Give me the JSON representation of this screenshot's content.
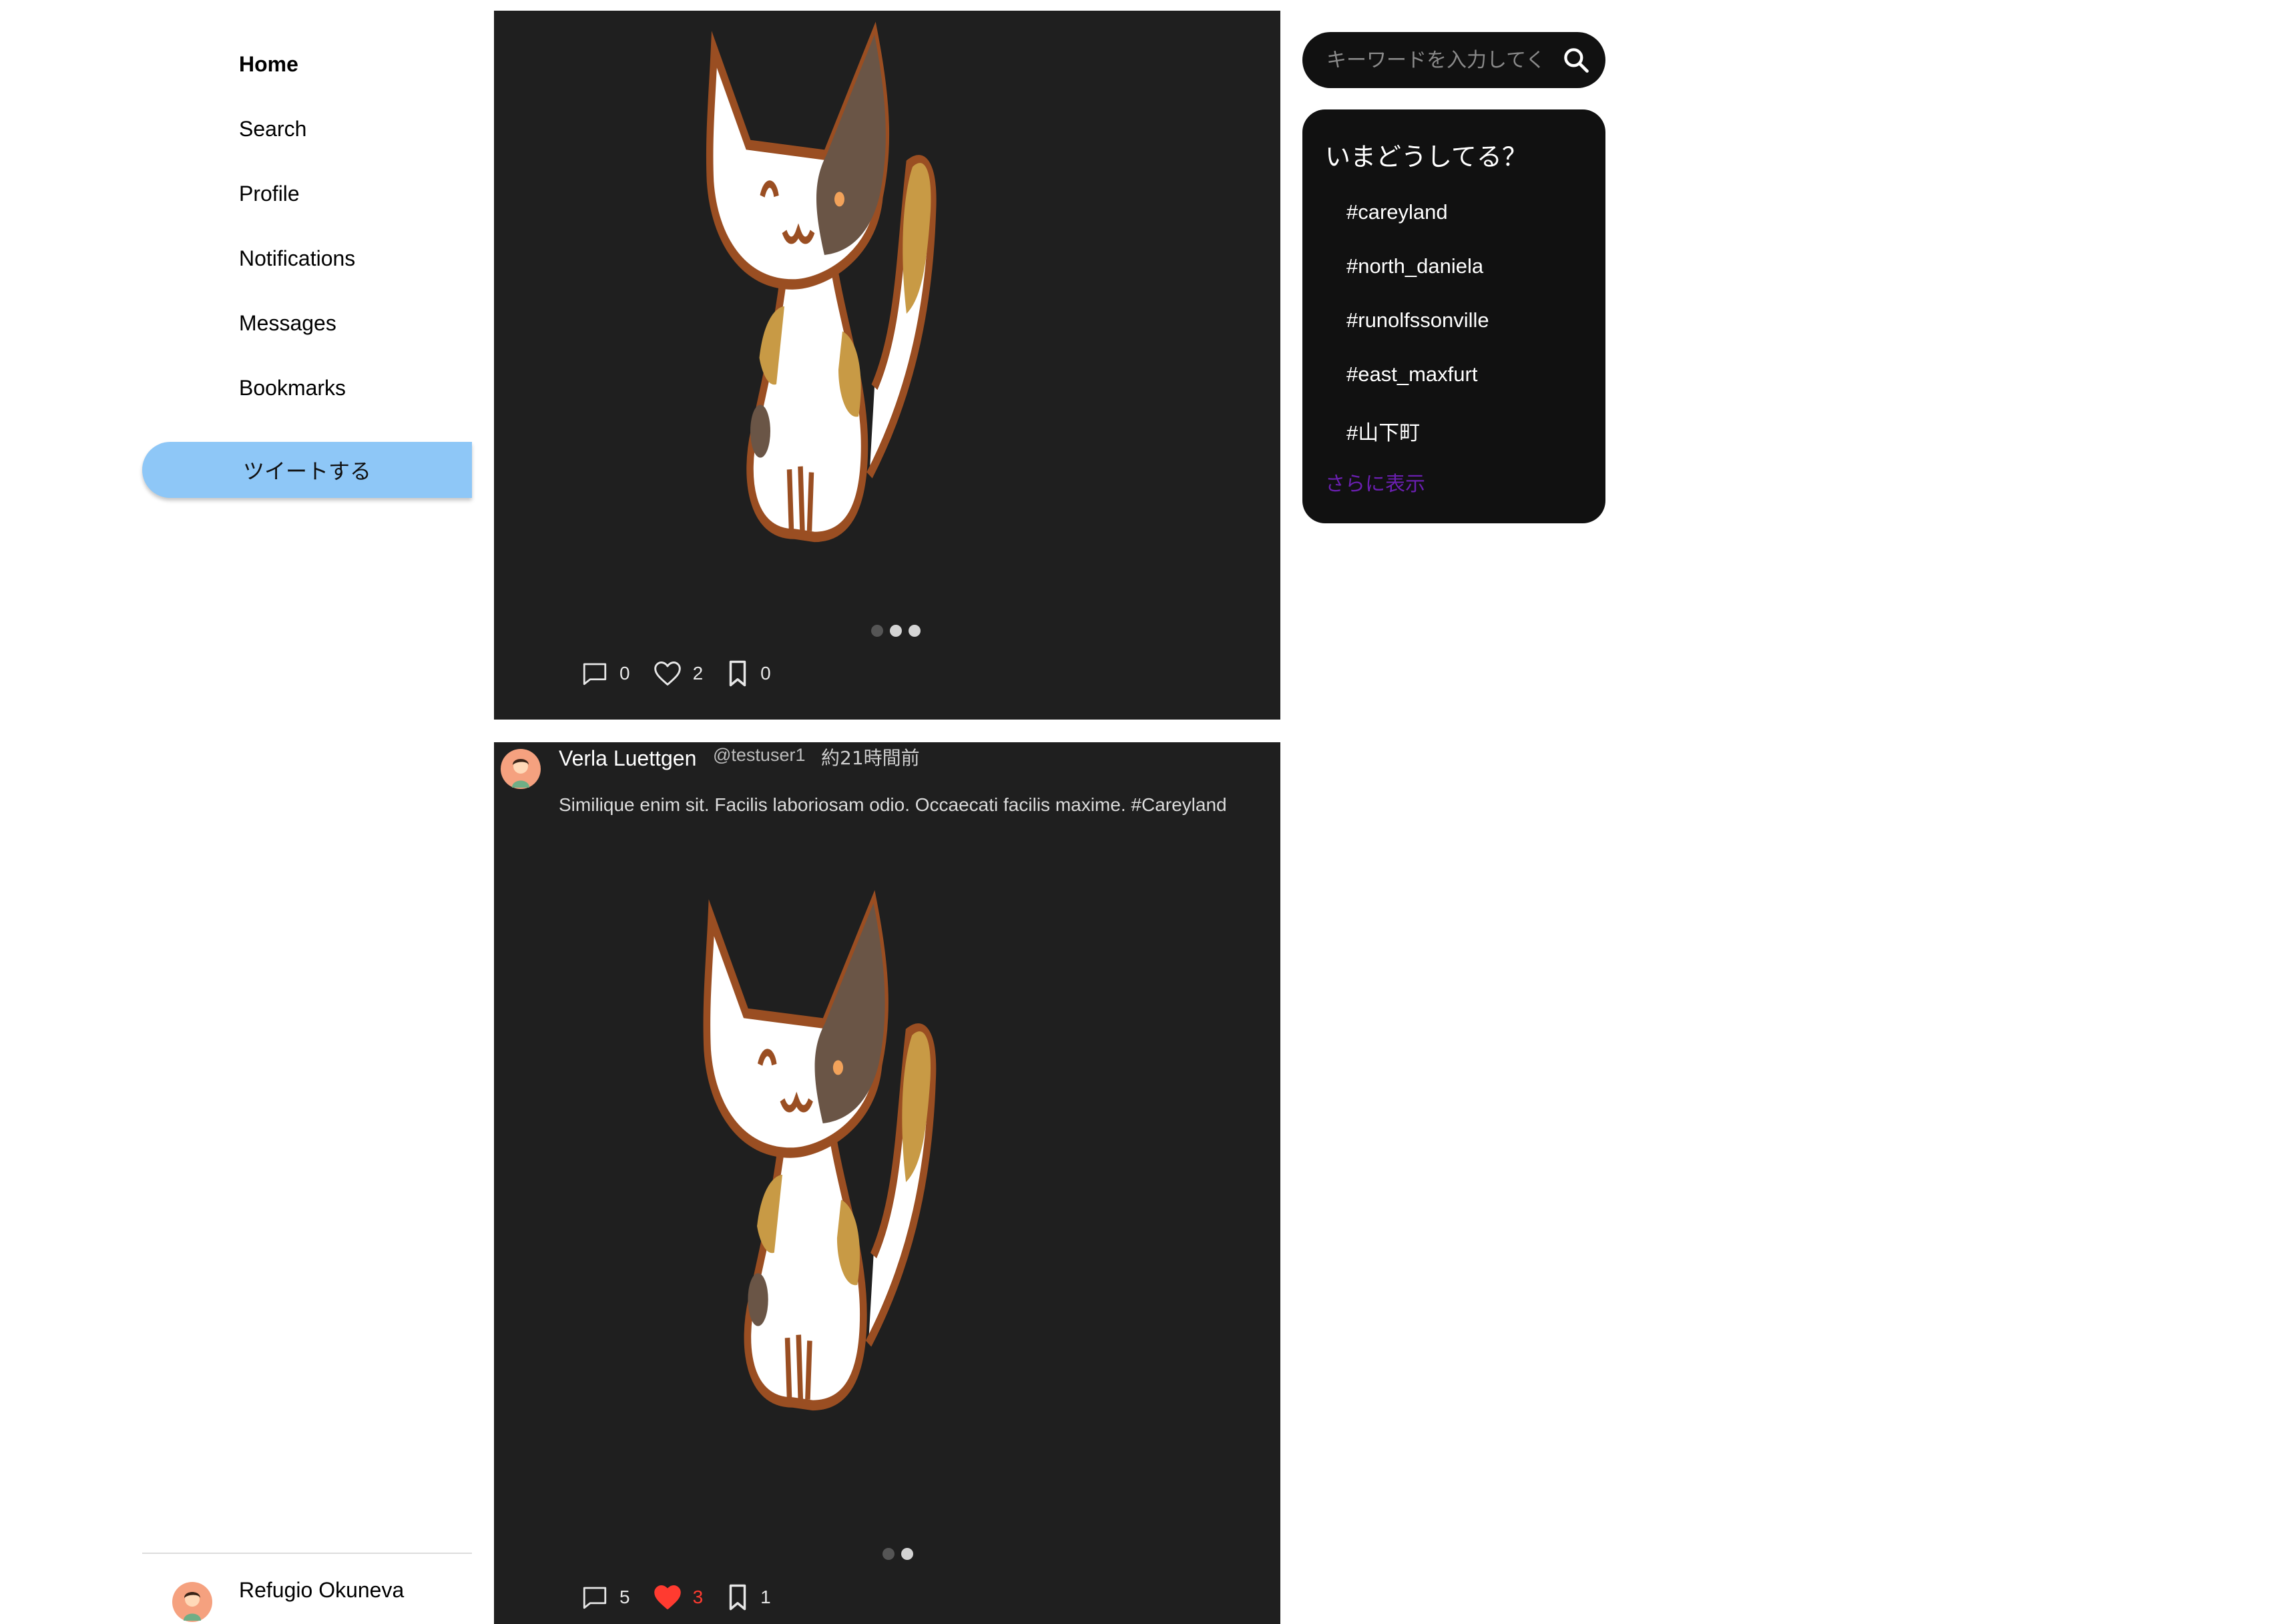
{
  "sidebar": {
    "nav": [
      {
        "label": "Home"
      },
      {
        "label": "Search"
      },
      {
        "label": "Profile"
      },
      {
        "label": "Notifications"
      },
      {
        "label": "Messages"
      },
      {
        "label": "Bookmarks"
      }
    ],
    "tweet_button": "ツイートする",
    "current_user": "Refugio Okuneva"
  },
  "posts": [
    {
      "images_total": 3,
      "active_image": 2,
      "comments": "0",
      "likes": "2",
      "bookmarks": "0",
      "liked": false
    },
    {
      "author": "Verla Luettgen",
      "handle": "@testuser1",
      "time": "約21時間前",
      "text": "Similique enim sit. Facilis laboriosam odio. Occaecati facilis maxime. #Careyland",
      "images_total": 2,
      "active_image": 2,
      "comments": "5",
      "likes": "3",
      "bookmarks": "1",
      "liked": true
    }
  ],
  "search": {
    "placeholder": "キーワードを入力してください"
  },
  "trends": {
    "title": "いまどうしてる？",
    "items": [
      "#careyland",
      "#north_daniela",
      "#runolfssonville",
      "#east_maxfurt",
      "#山下町"
    ],
    "more": "さらに表示"
  },
  "colors": {
    "tweet_button": "#8ec7f7",
    "post_bg": "#1f1f1f",
    "panel_bg": "#111111",
    "like_active": "#ff3b30",
    "more_link": "#6a1fb0"
  }
}
